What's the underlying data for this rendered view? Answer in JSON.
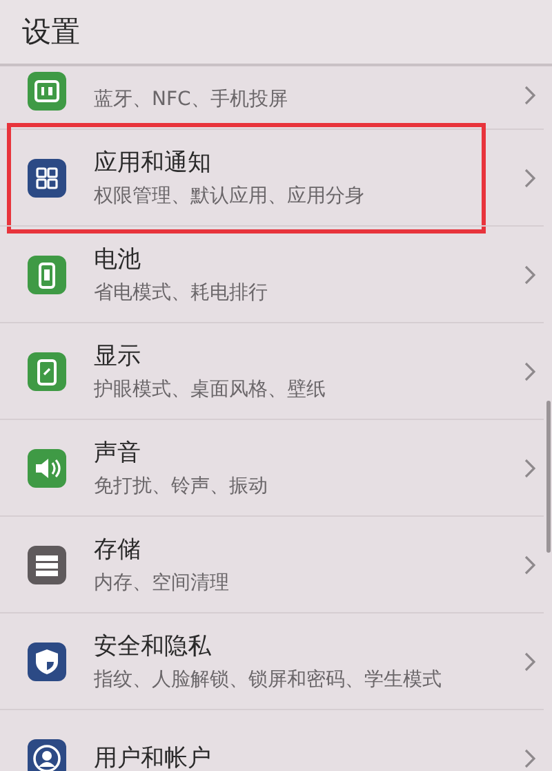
{
  "header": {
    "title": "设置"
  },
  "items": [
    {
      "subtitle": "蓝牙、NFC、手机投屏",
      "color": "#3f9a45",
      "highlighted": false
    },
    {
      "title": "应用和通知",
      "subtitle": "权限管理、默认应用、应用分身",
      "color": "#2c4a85",
      "highlighted": true
    },
    {
      "title": "电池",
      "subtitle": "省电模式、耗电排行",
      "color": "#3f9a45",
      "highlighted": false
    },
    {
      "title": "显示",
      "subtitle": "护眼模式、桌面风格、壁纸",
      "color": "#3f9a45",
      "highlighted": false
    },
    {
      "title": "声音",
      "subtitle": "免打扰、铃声、振动",
      "color": "#3f9a45",
      "highlighted": false
    },
    {
      "title": "存储",
      "subtitle": "内存、空间清理",
      "color": "#5f5a5c",
      "highlighted": false
    },
    {
      "title": "安全和隐私",
      "subtitle": "指纹、人脸解锁、锁屏和密码、学生模式",
      "color": "#2c4a85",
      "highlighted": false
    },
    {
      "title": "用户和帐户",
      "color": "#2c4a85",
      "highlighted": false
    }
  ]
}
